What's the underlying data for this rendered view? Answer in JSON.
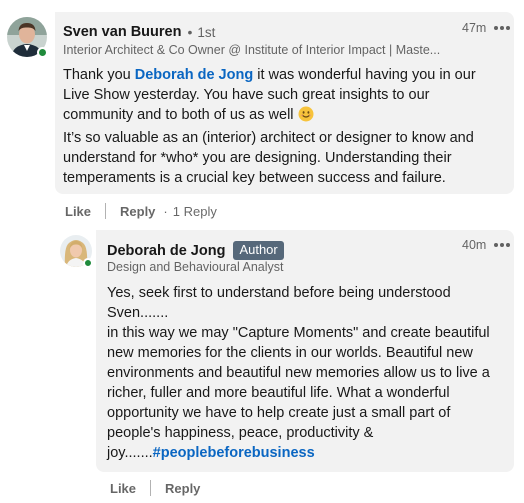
{
  "comment": {
    "author_name": "Sven van Buuren",
    "degree": "1st",
    "headline": "Interior Architect & Co Owner @ Institute of Interior Impact | Maste...",
    "time": "47m",
    "text": {
      "before_mention": "Thank you ",
      "mention": "Deborah de Jong",
      "after_mention": " it was wonderful having you in our Live Show yesterday. You have such great insights to our community and to both of us as well ",
      "emoji": "😊",
      "paragraph2": "It’s so valuable as an (interior) architect or designer to know and understand for *who* you are designing. Understanding their temperaments is a crucial key between success and failure."
    },
    "actions": {
      "like": "Like",
      "reply": "Reply",
      "replies_count": "1 Reply"
    }
  },
  "reply": {
    "author_name": "Deborah de Jong",
    "badge": "Author",
    "headline": "Design and Behavioural Analyst",
    "time": "40m",
    "text": {
      "line1": "Yes, seek first to understand before being understood Sven.......",
      "line2_before_hashtag": "in this way we may \"Capture Moments\" and create beautiful new memories for the clients in our worlds. Beautiful new environments and beautiful new memories allow us to live a richer, fuller and more beautiful life. What a wonderful opportunity we have to help create just a small part of people's happiness, peace, productivity & joy.......",
      "hashtag": "#peoplebeforebusiness"
    },
    "actions": {
      "like": "Like",
      "reply": "Reply"
    }
  },
  "colors": {
    "link": "#0a66c2",
    "bubble": "#f2f2f2",
    "presence": "#1f8a3b",
    "author_badge": "#56687a"
  }
}
